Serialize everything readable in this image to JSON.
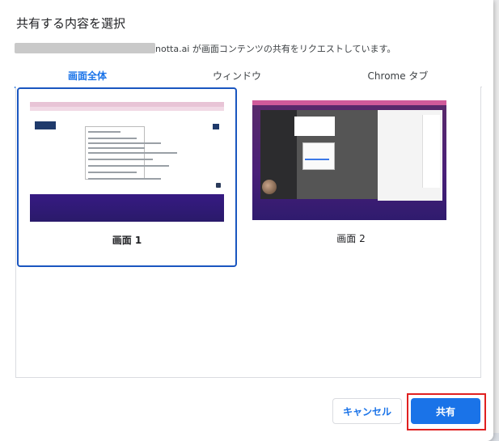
{
  "dialog": {
    "title": "共有する内容を選択",
    "subtitle_suffix": "notta.ai が画面コンテンツの共有をリクエストしています。"
  },
  "tabs": [
    {
      "label": "画面全体",
      "active": true
    },
    {
      "label": "ウィンドウ",
      "active": false
    },
    {
      "label": "Chrome タブ",
      "active": false
    }
  ],
  "screens": [
    {
      "label": "画面 1",
      "selected": true
    },
    {
      "label": "画面 2",
      "selected": false
    }
  ],
  "buttons": {
    "cancel_label": "キャンセル",
    "share_label": "共有"
  },
  "colors": {
    "accent": "#1a73e8",
    "highlight": "#e02020"
  }
}
